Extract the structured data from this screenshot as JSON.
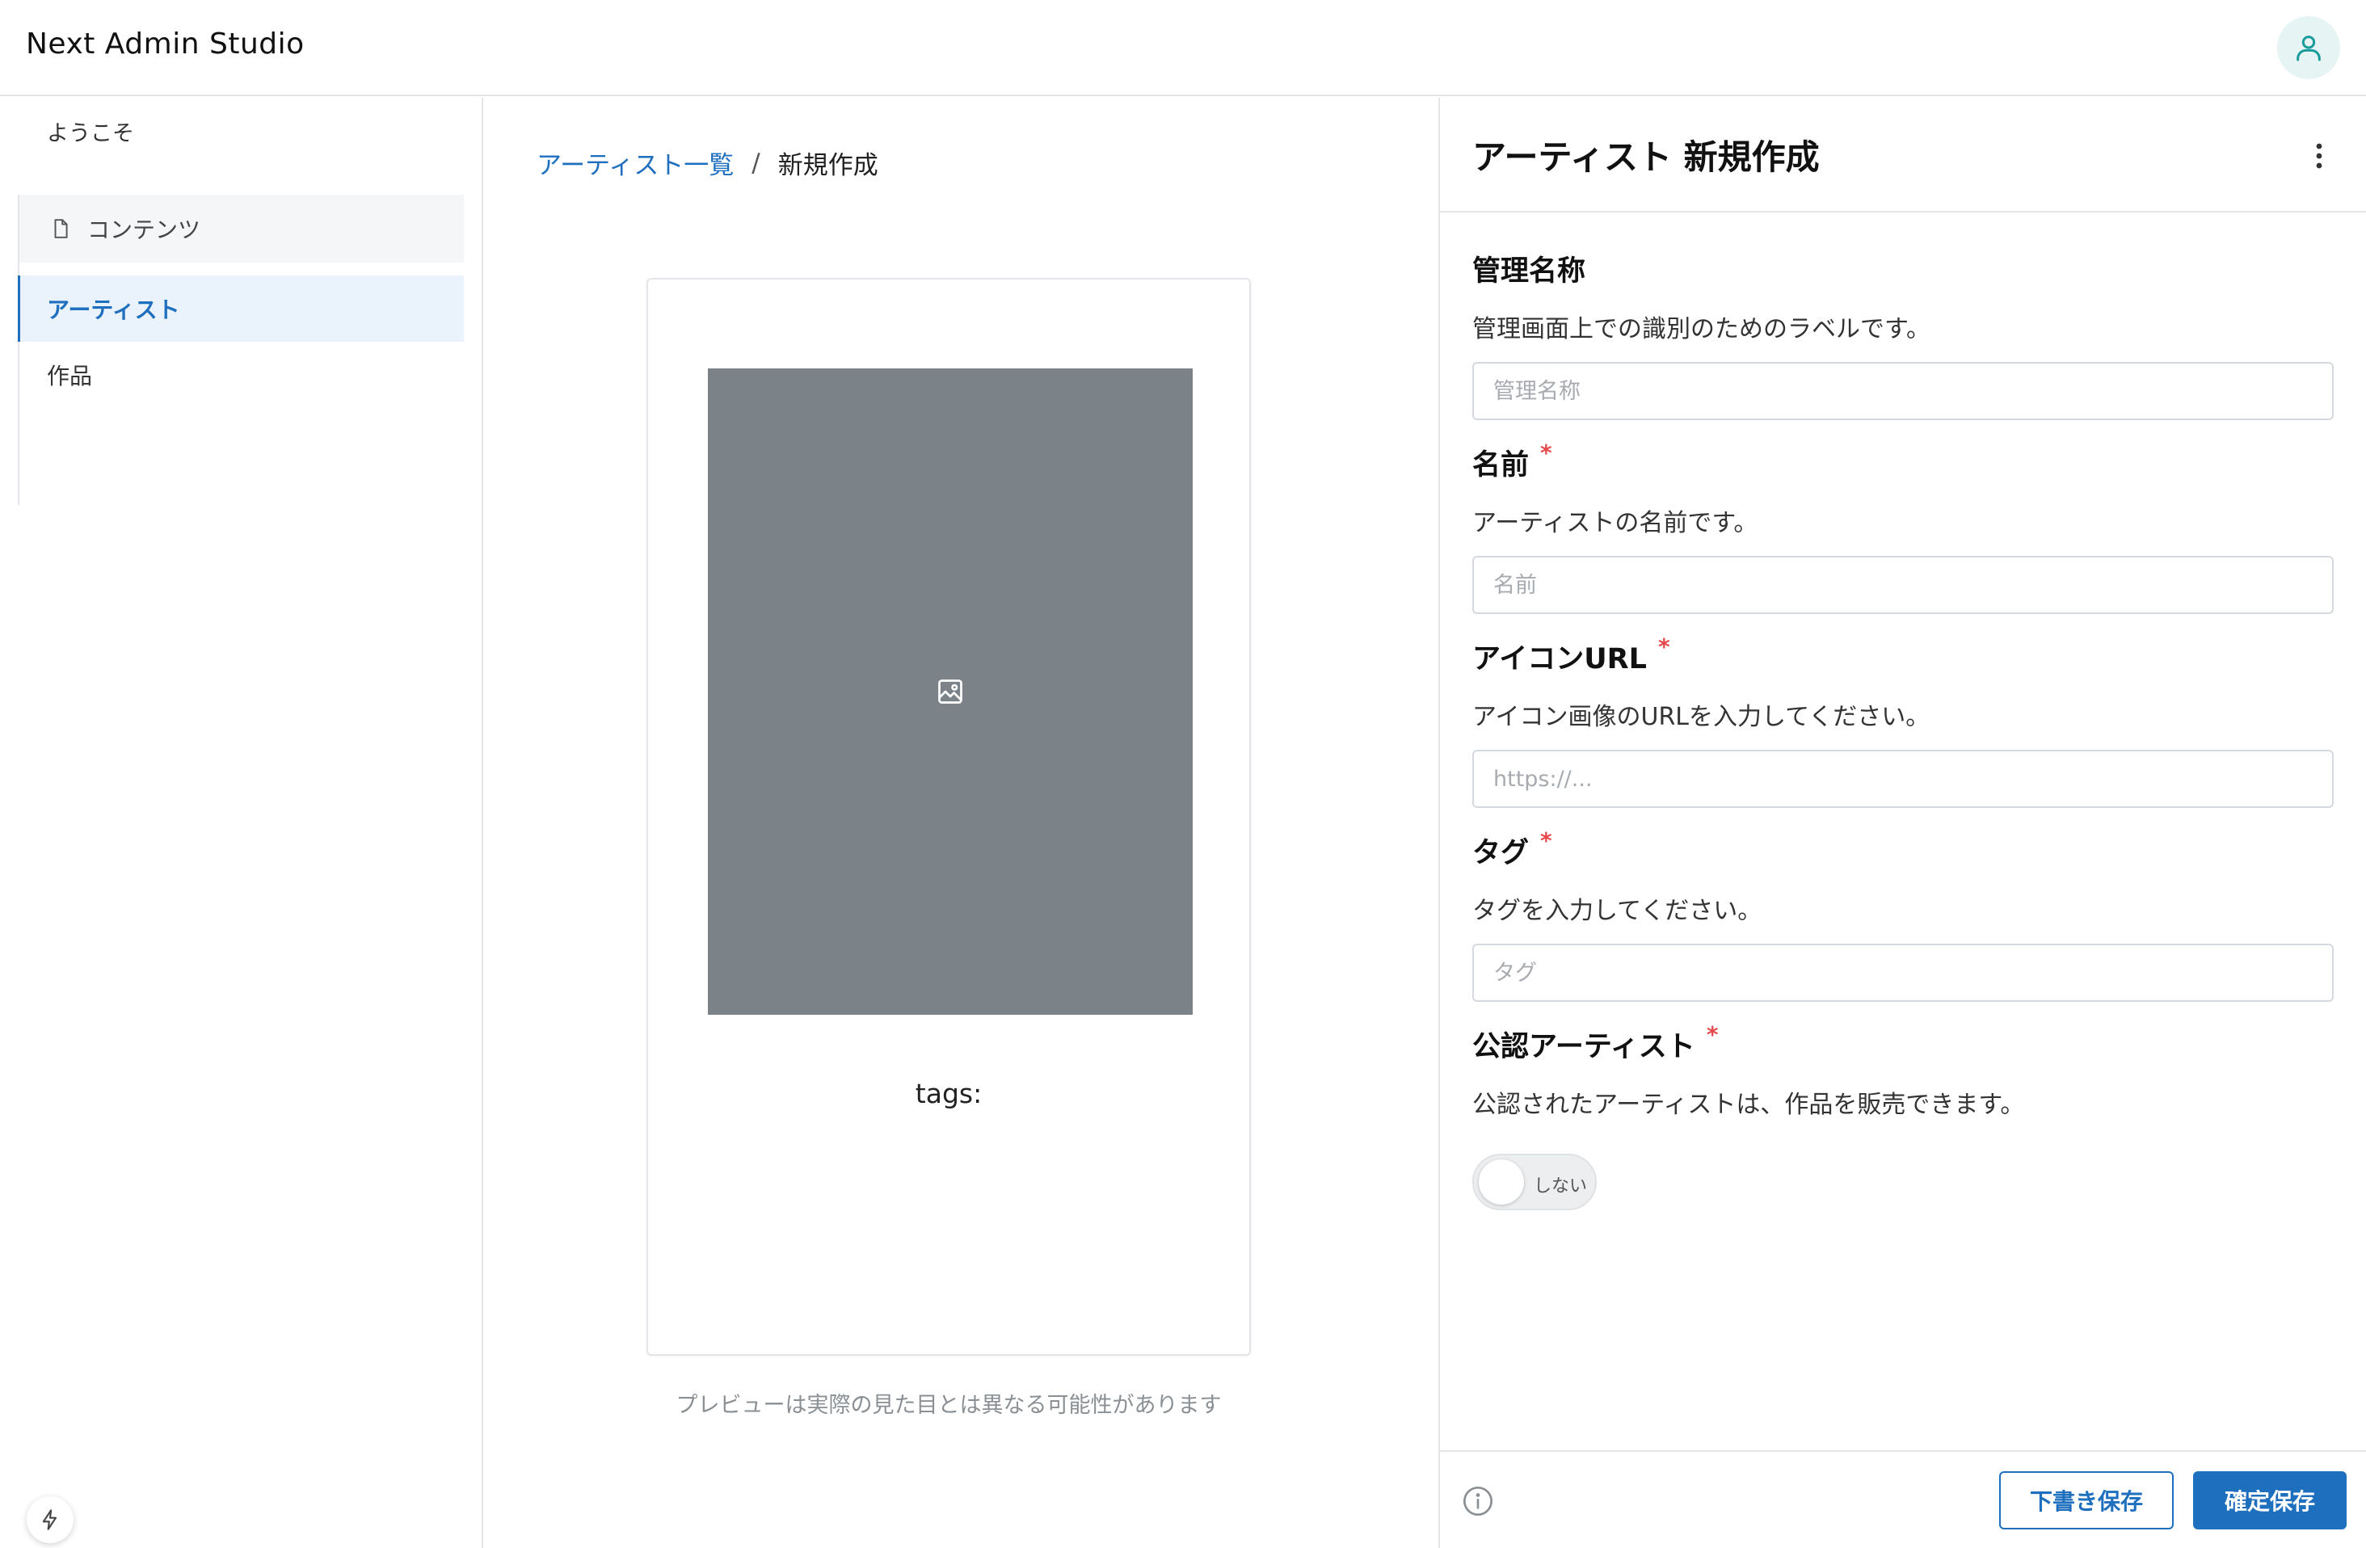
{
  "header": {
    "app_title": "Next Admin Studio",
    "avatar_icon": "user-icon",
    "accent": "#1a9c9c"
  },
  "sidebar": {
    "welcome": "ようこそ",
    "group_label": "コンテンツ",
    "group_icon": "document-icon",
    "items": [
      {
        "label": "アーティスト",
        "active": true
      },
      {
        "label": "作品",
        "active": false
      }
    ],
    "fab_icon": "lightning-icon"
  },
  "main": {
    "breadcrumb": {
      "parent": "アーティスト一覧",
      "separator": "/",
      "current": "新規作成"
    },
    "preview": {
      "image_icon": "image-icon",
      "image_color": "#7b8288",
      "tags_text": "tags:"
    },
    "note": "プレビューは実際の見た目とは異なる可能性があります"
  },
  "panel": {
    "title": "アーティスト 新規作成",
    "menu_icon": "more-vertical-icon",
    "fields": [
      {
        "label": "管理名称",
        "required": false,
        "description": "管理画面上での識別のためのラベルです。",
        "placeholder": "管理名称",
        "value": ""
      },
      {
        "label": "名前",
        "required": true,
        "description": "アーティストの名前です。",
        "placeholder": "名前",
        "value": ""
      },
      {
        "label": "アイコンURL",
        "required": true,
        "description": "アイコン画像のURLを入力してください。",
        "placeholder": "https://...",
        "value": ""
      },
      {
        "label": "タグ",
        "required": true,
        "description": "タグを入力してください。",
        "placeholder": "タグ",
        "value": ""
      },
      {
        "label": "公認アーティスト",
        "required": true,
        "description": "公認されたアーティストは、作品を販売できます。",
        "toggle_label": "しない",
        "toggle_on": false
      }
    ],
    "required_mark": "*",
    "required_color": "#e5484d",
    "footer": {
      "info_icon": "info-icon",
      "draft_label": "下書き保存",
      "publish_label": "確定保存",
      "primary_color": "#1f6fbf"
    }
  }
}
